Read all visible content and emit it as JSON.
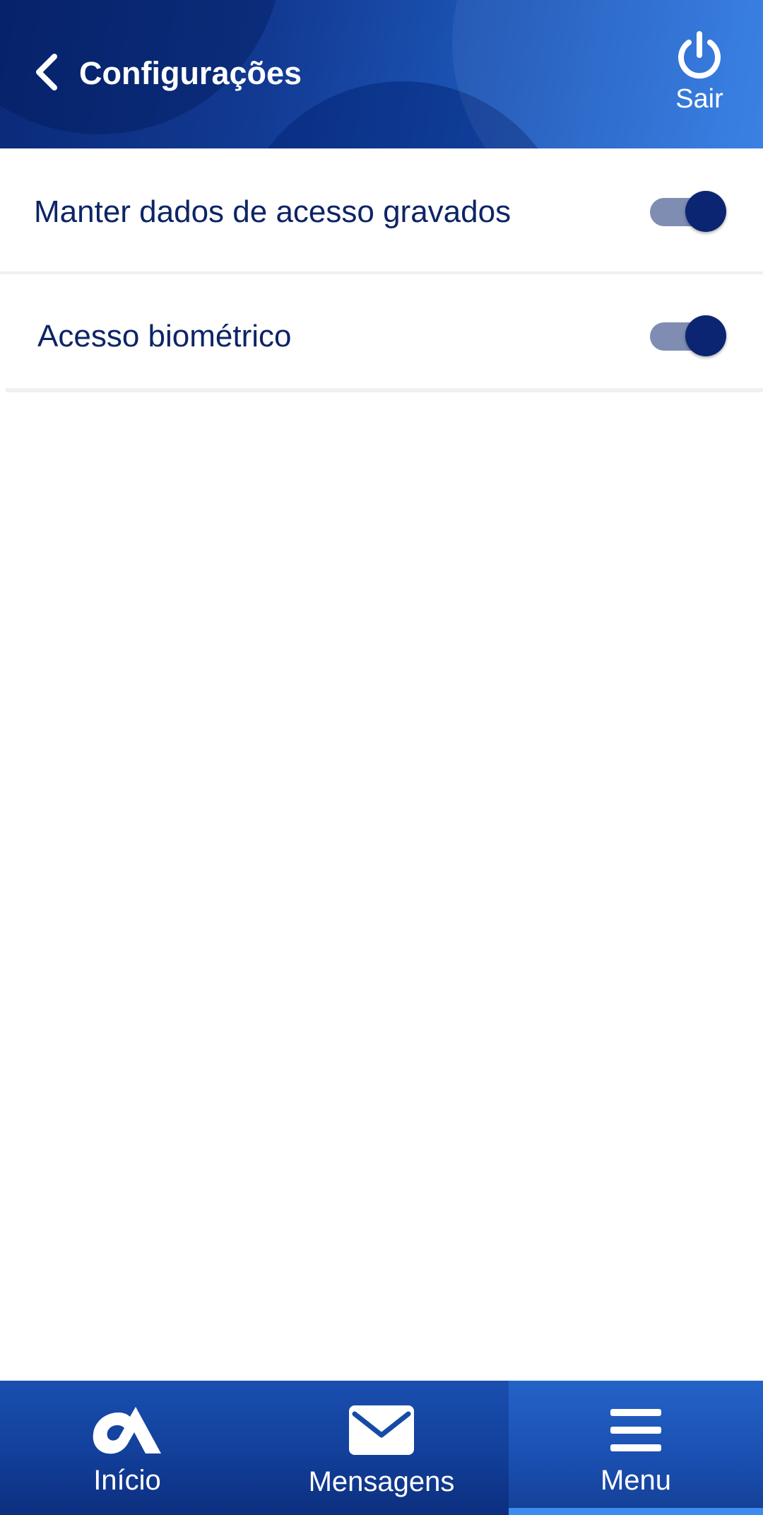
{
  "header": {
    "title": "Configurações",
    "back_icon": "chevron-left-icon",
    "logout": {
      "label": "Sair",
      "icon": "power-icon"
    }
  },
  "settings": [
    {
      "label": "Manter dados de acesso gravados",
      "enabled": true
    },
    {
      "label": "Acesso biométrico",
      "enabled": true
    }
  ],
  "bottom_nav": {
    "items": [
      {
        "label": "Início",
        "icon": "brand-logo-icon",
        "active": false
      },
      {
        "label": "Mensagens",
        "icon": "envelope-icon",
        "active": false
      },
      {
        "label": "Menu",
        "icon": "hamburger-menu-icon",
        "active": true
      }
    ]
  },
  "colors": {
    "header_start": "#0a2a78",
    "header_end": "#2e7ae3",
    "text_primary": "#0d2566",
    "toggle_thumb_on": "#0b2572",
    "toggle_track_on": "#7f8db3",
    "nav_active_indicator": "#3d8af0"
  }
}
